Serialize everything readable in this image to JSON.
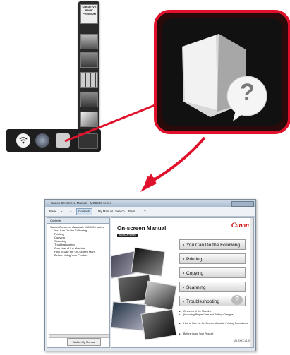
{
  "dock_vertical": {
    "first_label": "CREATIVE PARK PREMIUM",
    "items": [
      "creative-park-icon",
      "photo-icon",
      "print-icon",
      "grid-icon",
      "my-printer-icon",
      "scan-icon"
    ]
  },
  "dock_horizontal": {
    "items": [
      "wireless-icon",
      "network-icon",
      "manual-icon",
      "menu-icon"
    ]
  },
  "callout": {
    "accent": "#e0112b"
  },
  "window": {
    "title": "Canon On-screen Manual - MG6000 series",
    "toolbar": {
      "back": "Back",
      "forward": "",
      "contents": "Contents",
      "my_manual": "My Manual",
      "search": "Search",
      "print": "Print",
      "help": ""
    },
    "contents_tab": "Contents",
    "tree": [
      "Canon On-screen Manual - MG6000 series",
      "You Can Do the Following",
      "Printing",
      "Copying",
      "Scanning",
      "Troubleshooting",
      "Overview of the Machine",
      "How to Use the On-Screen Man.",
      "Before Using Your Product"
    ],
    "add_to_my_manual": "Add to My Manual",
    "heading": "On-screen Manual",
    "model_badge": "MG6000 series",
    "brand": "Canon",
    "nav": [
      "You Can Do the Following",
      "Printing",
      "Copying",
      "Scanning",
      "Troubleshooting"
    ],
    "subs": [
      "Overview of the Machine",
      "(Including Proper Care and Setting Changes)",
      "How to Use the On-Screen Manuals, Printing Procedures",
      "Before Using Your Product"
    ],
    "doc_id": "MD-XXXX-V1.00"
  }
}
